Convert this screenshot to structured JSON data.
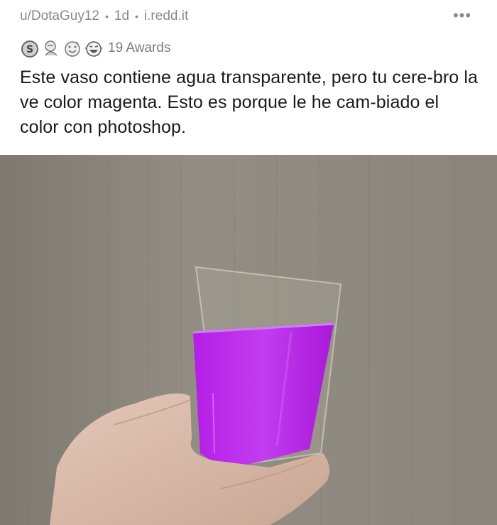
{
  "post": {
    "author": "u/DotaGuy12",
    "separator": "•",
    "age": "1d",
    "domain": "i.redd.it",
    "more_label": "•••",
    "awards": {
      "icons": [
        "silver-award-icon",
        "helpful-award-icon",
        "wholesome-award-icon",
        "laughing-award-icon"
      ],
      "count_label": "19 Awards"
    },
    "title": "Este vaso contiene agua transparente, pero tu cere-bro la ve color magenta. Esto es porque le he cam-biado el color con photoshop.",
    "image": {
      "subject": "hand-holding-glass",
      "liquid_color": "#b320e6",
      "wall_color": "#8f8a7e"
    }
  }
}
